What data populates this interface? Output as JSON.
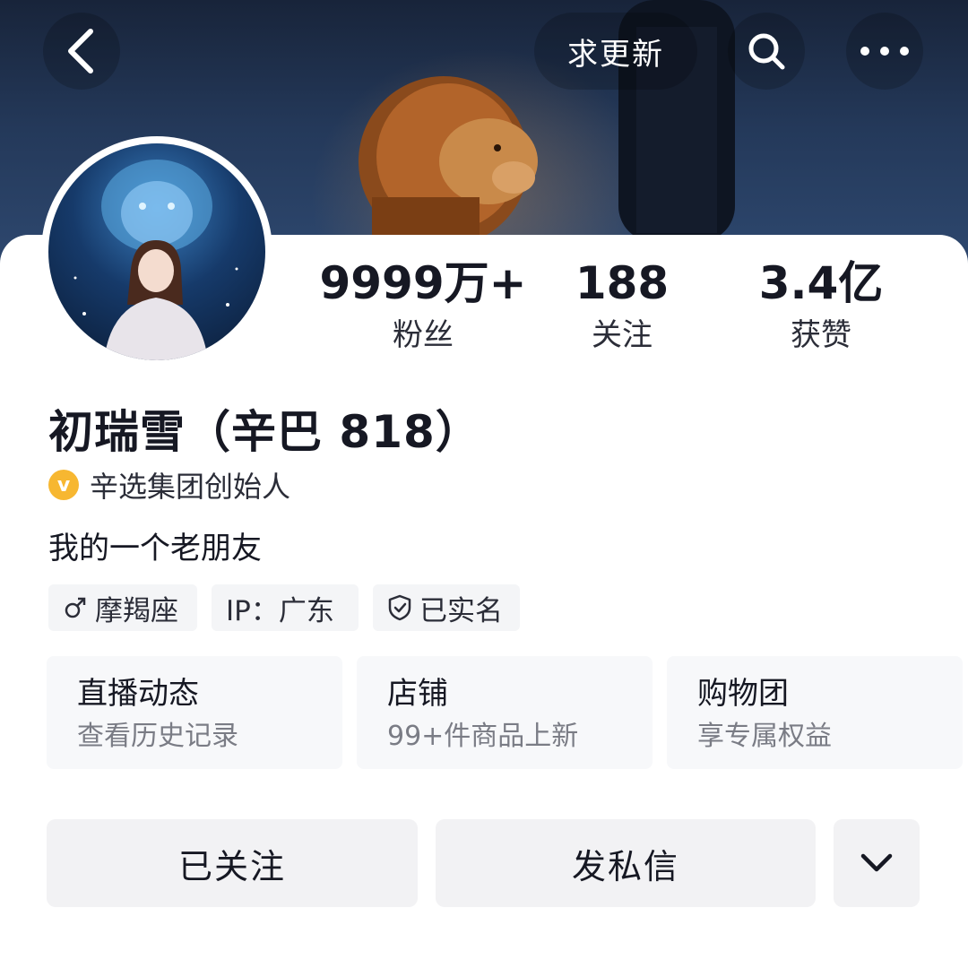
{
  "header": {
    "back_icon": "chevron-left-icon",
    "update_label": "求更新",
    "search_icon": "search-icon",
    "more_icon": "more-dots-icon"
  },
  "stats": [
    {
      "value": "9999万+",
      "label": "粉丝"
    },
    {
      "value": "188",
      "label": "关注"
    },
    {
      "value": "3.4亿",
      "label": "获赞"
    }
  ],
  "profile": {
    "name": "初瑞雪（辛巴 818）",
    "verified_text": "辛选集团创始人",
    "bio": "我的一个老朋友"
  },
  "tags": {
    "gender_zodiac": "摩羯座",
    "ip": "IP：广东",
    "real_name": "已实名"
  },
  "cards": [
    {
      "title": "直播动态",
      "subtitle": "查看历史记录"
    },
    {
      "title": "店铺",
      "subtitle": "99+件商品上新"
    },
    {
      "title": "购物团",
      "subtitle": "享专属权益"
    }
  ],
  "actions": {
    "followed": "已关注",
    "message": "发私信",
    "expand_icon": "chevron-down-icon"
  },
  "colors": {
    "banner": "#24395a",
    "verify_badge": "#f7b731",
    "chip_bg": "#f4f5f7",
    "button_bg": "#f2f2f4"
  }
}
